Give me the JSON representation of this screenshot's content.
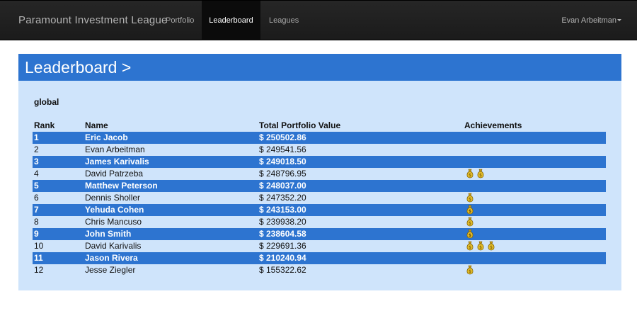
{
  "navbar": {
    "brand": "Paramount Investment League",
    "links": [
      {
        "label": "Portfolio"
      },
      {
        "label": "Leaderboard",
        "active": true
      },
      {
        "label": "Leagues"
      }
    ],
    "user": "Evan Arbeitman"
  },
  "panel": {
    "title": "Leaderboard >",
    "scope": "global"
  },
  "table": {
    "headers": [
      "Rank",
      "Name",
      "Total Portfolio Value",
      "Achievements"
    ],
    "rows": [
      {
        "rank": "1",
        "name": "Eric Jacob",
        "value": "$ 250502.86",
        "achievements": 0
      },
      {
        "rank": "2",
        "name": "Evan Arbeitman",
        "value": "$ 249541.56",
        "achievements": 0
      },
      {
        "rank": "3",
        "name": "James Karivalis",
        "value": "$ 249018.50",
        "achievements": 0
      },
      {
        "rank": "4",
        "name": "David Patrzeba",
        "value": "$ 248796.95",
        "achievements": 2
      },
      {
        "rank": "5",
        "name": "Matthew Peterson",
        "value": "$ 248037.00",
        "achievements": 0
      },
      {
        "rank": "6",
        "name": "Dennis Sholler",
        "value": "$ 247352.20",
        "achievements": 1
      },
      {
        "rank": "7",
        "name": "Yehuda Cohen",
        "value": "$ 243153.00",
        "achievements": 1
      },
      {
        "rank": "8",
        "name": "Chris Mancuso",
        "value": "$ 239938.20",
        "achievements": 1
      },
      {
        "rank": "9",
        "name": "John Smith",
        "value": "$ 238604.58",
        "achievements": 1
      },
      {
        "rank": "10",
        "name": "David Karivalis",
        "value": "$ 229691.36",
        "achievements": 3
      },
      {
        "rank": "11",
        "name": "Jason Rivera",
        "value": "$ 210240.94",
        "achievements": 0
      },
      {
        "rank": "12",
        "name": "Jesse Ziegler",
        "value": "$ 155322.62",
        "achievements": 1
      }
    ]
  },
  "icons": {
    "achievement": "money-bag-icon",
    "dropdown": "caret-down-icon"
  },
  "colors": {
    "navbar": "#1f1f1f",
    "accent": "#2d74d0",
    "panel_bg": "#cfe4fb",
    "bag_gold": "#d9b11c"
  }
}
